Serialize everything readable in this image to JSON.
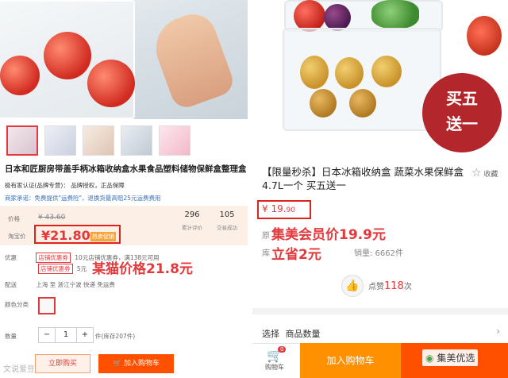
{
  "left": {
    "title": "日本和匠厨房带盖手柄冰箱收纳盒水果食品塑料储物保鲜盒整理盒",
    "meta": "极有家认证(品牌专营)： 品牌授权，正品保障",
    "promo_line": "商家承诺：免费提供\"运费险\"，退换货最高赔25元运费费用",
    "price_label": "价格",
    "old_price": "¥ 43.60",
    "tmall_label": "淘宝价",
    "tmall_price": "¥21.80",
    "tmall_badge": "热卖促销",
    "stats": [
      {
        "num": "296",
        "label": "累计评价"
      },
      {
        "num": "105",
        "label": "交易成功"
      }
    ],
    "promo_label": "优惠",
    "promo_items": [
      {
        "tag": "店铺优惠券",
        "text": "10元店铺优惠券，满138元可用"
      },
      {
        "tag": "店铺优惠券",
        "text": "5元"
      }
    ],
    "overlay_tmall": "某猫价格21.8元",
    "ship_label": "配送",
    "ship_text": "上海 至 浙江宁波 快递 免运费",
    "color_label": "颜色分类",
    "qty_label": "数量",
    "qty_minus": "−",
    "qty_value": "1",
    "qty_plus": "+",
    "stock": "件(库存207件)",
    "buy_now": "立即购买",
    "add_cart": "加入购物车",
    "watermark": "文说爱豆"
  },
  "right": {
    "badge_line1": "买五",
    "badge_line2": "送一",
    "title": "【限量秒杀】日本冰箱收纳盒 蔬菜水果保鲜盒4.7L一个 买五送一",
    "fav": "收藏",
    "price_main": "¥ 19.",
    "price_decimal": "90",
    "orig_label": "原",
    "stock_label": "库",
    "overlay_member": "集美会员价19.9元",
    "overlay_save": "立省2元",
    "sales": "销量: 6662件",
    "likes_prefix": "点赞",
    "likes_count": "118",
    "likes_suffix": "次",
    "select_label": "选择",
    "select_value": "商品数量",
    "cart_badge": "0",
    "cart_label": "购物车",
    "add_cart": "加入购物车",
    "buy_now": "立即购买",
    "watermark": "集美优选"
  }
}
